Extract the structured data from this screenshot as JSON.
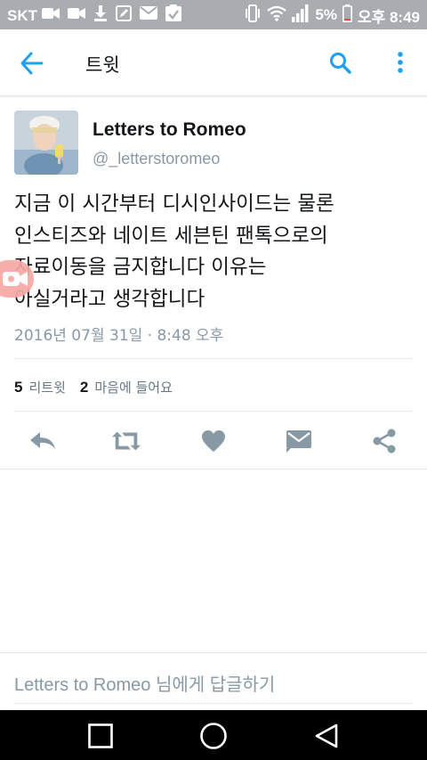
{
  "status_bar": {
    "carrier": "SKT",
    "battery": "5%",
    "time": "오후 8:49",
    "icons": [
      "video-camera-icon",
      "video-camera-icon",
      "download-icon",
      "edit-icon",
      "mail-icon",
      "clipboard-check-icon",
      "vibrate-icon",
      "wifi-icon",
      "signal-icon",
      "battery-icon"
    ]
  },
  "app_bar": {
    "title": "트윗",
    "icons": [
      "back-arrow-icon",
      "search-icon",
      "more-vert-icon"
    ]
  },
  "tweet": {
    "author_name": "Letters to Romeo",
    "author_handle": "@_letterstoromeo",
    "text_lines": [
      "지금 이 시간부터 디시인사이드는 물론",
      "인스티즈와 네이트 세븐틴 팬톡으로의",
      "자료이동을 금지합니다 이유는",
      "아실거라고 생각합니다"
    ],
    "timestamp": "2016년 07월 31일 · 8:48 오후",
    "retweet_count": "5",
    "retweet_label": "리트윗",
    "like_count": "2",
    "like_label": "마음에 들어요"
  },
  "actions": [
    "reply-icon",
    "retweet-icon",
    "heart-icon",
    "direct-message-icon",
    "share-icon"
  ],
  "reply_box": {
    "placeholder": "Letters to Romeo 님에게 답글하기"
  },
  "colors": {
    "accent": "#1da1f2",
    "action_gray": "#8899a6",
    "status_bar_bg": "#a9acb0"
  },
  "nav_bar": [
    "recents-square-icon",
    "home-circle-icon",
    "back-triangle-icon"
  ]
}
